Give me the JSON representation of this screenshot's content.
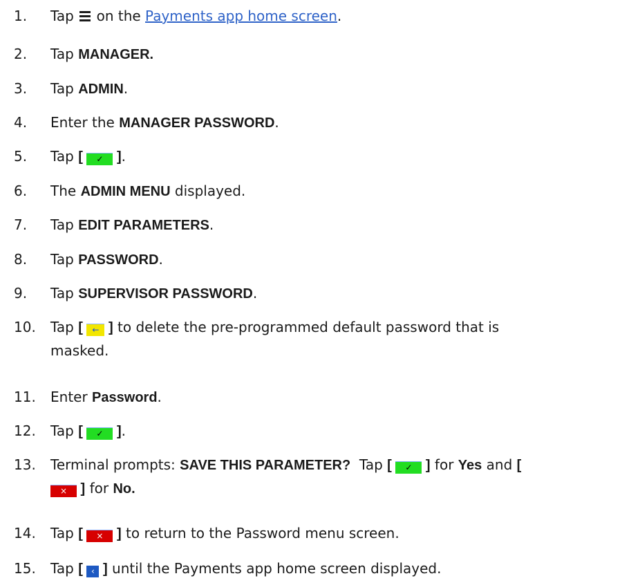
{
  "steps": [
    {
      "num": "1.",
      "parts": [
        {
          "text": "Tap "
        },
        {
          "icon": "menu-icon"
        },
        {
          "text": " on the "
        },
        {
          "link": "Payments app home screen"
        },
        {
          "text": "."
        }
      ]
    },
    {
      "num": "2.",
      "parts": [
        {
          "text": "Tap "
        },
        {
          "bold": "MANAGER."
        }
      ]
    },
    {
      "num": "3.",
      "parts": [
        {
          "text": "Tap "
        },
        {
          "bold": "ADMIN"
        },
        {
          "text": "."
        }
      ]
    },
    {
      "num": "4.",
      "parts": [
        {
          "text": "Enter the "
        },
        {
          "bold": "MANAGER PASSWORD"
        },
        {
          "text": "."
        }
      ]
    },
    {
      "num": "5.",
      "parts": [
        {
          "text": "Tap "
        },
        {
          "bracket": "[ "
        },
        {
          "key": "ok"
        },
        {
          "bracket": " ]"
        },
        {
          "text": "."
        }
      ]
    },
    {
      "num": "6.",
      "parts": [
        {
          "text": "The "
        },
        {
          "bold": "ADMIN MENU"
        },
        {
          "text": " displayed."
        }
      ]
    },
    {
      "num": "7.",
      "parts": [
        {
          "text": "Tap "
        },
        {
          "bold": "EDIT PARAMETERS"
        },
        {
          "text": "."
        }
      ]
    },
    {
      "num": "8.",
      "parts": [
        {
          "text": "Tap "
        },
        {
          "bold": "PASSWORD"
        },
        {
          "text": "."
        }
      ]
    },
    {
      "num": "9.",
      "parts": [
        {
          "text": "Tap "
        },
        {
          "bold": "SUPERVISOR PASSWORD"
        },
        {
          "text": "."
        }
      ]
    },
    {
      "num": "10.",
      "parts": [
        {
          "text": "Tap "
        },
        {
          "bracket": "[ "
        },
        {
          "key": "back"
        },
        {
          "bracket": " ]"
        },
        {
          "text": " to delete the pre-programmed default password that is"
        }
      ],
      "line2": "masked."
    },
    {
      "num": "11.",
      "parts": [
        {
          "text": "Enter "
        },
        {
          "bold": "Password"
        },
        {
          "text": "."
        }
      ]
    },
    {
      "num": "12.",
      "parts": [
        {
          "text": "Tap "
        },
        {
          "bracket": "[ "
        },
        {
          "key": "ok"
        },
        {
          "bracket": " ]"
        },
        {
          "text": "."
        }
      ]
    },
    {
      "num": "13.",
      "parts": [
        {
          "text": "Terminal prompts: "
        },
        {
          "bold": "SAVE THIS PARAMETER?"
        },
        {
          "text": "  Tap "
        },
        {
          "bracket": "[ "
        },
        {
          "key": "ok"
        },
        {
          "bracket": " ]"
        },
        {
          "text": " for "
        },
        {
          "bold": "Yes"
        },
        {
          "text": " and "
        },
        {
          "bracket": "["
        }
      ],
      "parts2": [
        {
          "key": "x"
        },
        {
          "bracket": " ]"
        },
        {
          "text": " for "
        },
        {
          "bold": "No."
        }
      ]
    },
    {
      "num": "14.",
      "parts": [
        {
          "text": "Tap "
        },
        {
          "bracket": "[ "
        },
        {
          "key": "x"
        },
        {
          "bracket": " ]"
        },
        {
          "text": " to return to the Password menu screen."
        }
      ]
    },
    {
      "num": "15.",
      "parts": [
        {
          "text": "Tap "
        },
        {
          "bracket": "[ "
        },
        {
          "key": "home"
        },
        {
          "bracket": " ]"
        },
        {
          "text": " until the Payments app home screen displayed."
        }
      ]
    }
  ],
  "keys": {
    "ok": {
      "glyph": "✓",
      "name": "confirm-key-icon",
      "color": "#22dd22"
    },
    "back": {
      "glyph": "←",
      "name": "backspace-key-icon",
      "color": "#f2e600"
    },
    "x": {
      "glyph": "×",
      "name": "cancel-key-icon",
      "color": "#d70000"
    },
    "home": {
      "glyph": "‹",
      "name": "back-key-icon",
      "color": "#1d59c2"
    }
  },
  "colors": {
    "link": "#2f63c8",
    "text": "#1a1a1a"
  }
}
